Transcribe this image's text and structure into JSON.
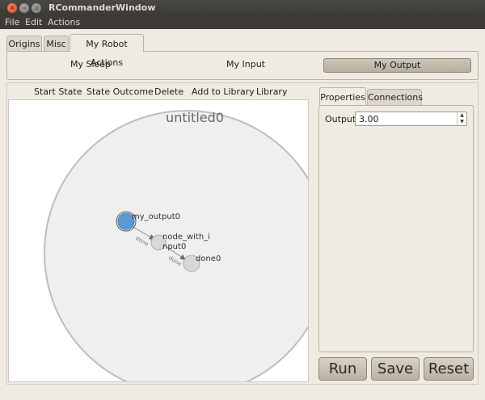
{
  "window": {
    "title": "RCommanderWindow"
  },
  "menu": {
    "file": "File",
    "edit": "Edit",
    "actions": "Actions"
  },
  "top_tabs": [
    "Origins",
    "Misc",
    "My Robot Actions"
  ],
  "actions_panel": {
    "sleep": "My Sleep",
    "input": "My Input",
    "output": "My Output"
  },
  "toolbar": {
    "start_state": "Start State",
    "state_outcome": "State Outcome",
    "delete": "Delete",
    "add_to_library": "Add to Library",
    "library": "Library"
  },
  "graph": {
    "title": "untitled0",
    "nodes": [
      "my_output0",
      "node_with_i",
      "nput0",
      "done0"
    ],
    "edges": [
      "done",
      "done"
    ]
  },
  "right_tabs": [
    "Properties",
    "Connections"
  ],
  "properties": {
    "output_label": "Output",
    "output_value": "3.00"
  },
  "buttons": {
    "run": "Run",
    "save": "Save",
    "reset": "Reset"
  },
  "colors": {
    "active_node": "#5b9bd5",
    "inactive_node": "#d8d8d8",
    "boundary": "#efefef"
  }
}
